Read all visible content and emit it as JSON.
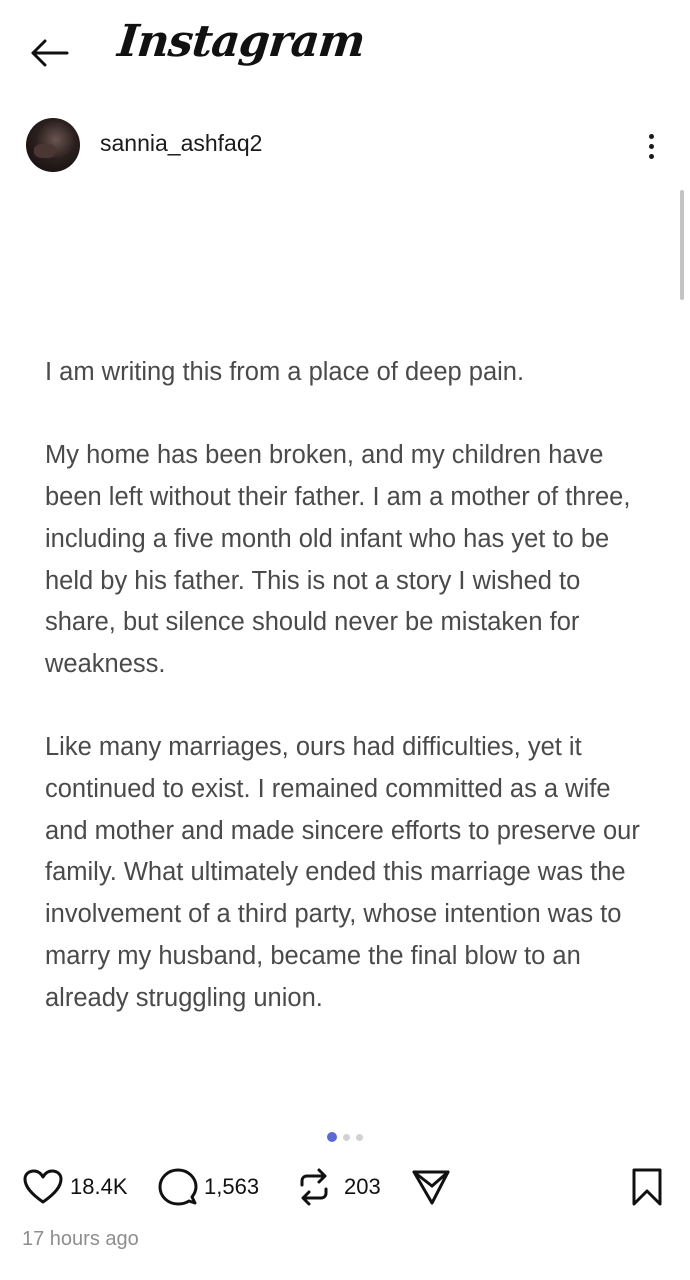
{
  "header": {
    "logo": "Instagram",
    "back_icon": "arrow-left-icon"
  },
  "post": {
    "username": "sannia_ashfaq2",
    "more_icon": "more-vertical-icon",
    "paragraphs": [
      "I am writing this from a place of deep pain.",
      "My home has been broken, and my children have been left without their father. I am a mother of three, including a five month old infant who has yet to be held by his father. This is not a story I wished to share, but silence should never be mistaken for weakness.",
      "Like many marriages, ours had difficulties, yet it continued to exist. I remained committed as a wife and mother and made sincere efforts to preserve our family. What ultimately ended this marriage was the involvement of a third party, whose intention was to marry my husband, became the final blow to an already struggling union."
    ],
    "carousel": {
      "total": 3,
      "active_index": 0,
      "active_color": "#5a69d6"
    },
    "actions": {
      "likes": "18.4K",
      "comments": "1,563",
      "reposts": "203",
      "icons": [
        "heart-icon",
        "comment-icon",
        "repost-icon",
        "share-icon",
        "bookmark-icon"
      ]
    },
    "timestamp": "17 hours ago"
  }
}
